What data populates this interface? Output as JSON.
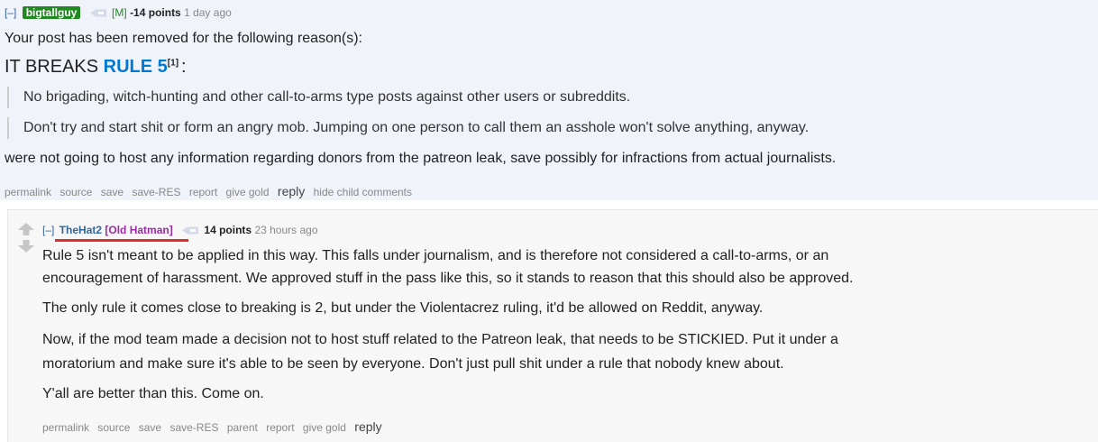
{
  "parent": {
    "expand": "[–]",
    "author": "bigtallguy",
    "mod_tag": "[M]",
    "score": "-14 points",
    "time": "1 day ago",
    "intro": "Your post has been removed for the following reason(s):",
    "breaks_prefix": "IT BREAKS ",
    "rule_label": "RULE 5",
    "footnote": "[1]",
    "breaks_suffix": ":",
    "quote_1": "No brigading, witch-hunting and other call-to-arms type posts against other users or subreddits.",
    "quote_2": "Don't try and start shit or form an angry mob. Jumping on one person to call them an asshole won't solve anything, anyway.",
    "closing": "were not going to host any information regarding donors from the patreon leak, save possibly for infractions from actual journalists.",
    "actions": {
      "permalink": "permalink",
      "source": "source",
      "save": "save",
      "save_res": "save-RES",
      "report": "report",
      "give_gold": "give gold",
      "reply": "reply",
      "hide_child": "hide child comments"
    }
  },
  "child": {
    "expand": "[–]",
    "author": "TheHat2",
    "flair": "[Old Hatman]",
    "score": "14 points",
    "time": "23 hours ago",
    "p1_line1": "Rule 5 isn't meant to be applied in this way. This falls under journalism, and is therefore not considered a call-to-arms, or an",
    "p1_line2": "encouragement of harassment. We approved stuff in the pass like this, so it stands to reason that this should also be approved.",
    "p2": "The only rule it comes close to breaking is 2, but under the Violentacrez ruling, it'd be allowed on Reddit, anyway.",
    "p3_line1": "Now, if the mod team made a decision not to host stuff related to the Patreon leak, that needs to be STICKIED. Put it under a",
    "p3_line2": "moratorium and make sure it's able to be seen by everyone. Don't just pull shit under a rule that nobody knew about.",
    "p4": "Y'all are better than this. Come on.",
    "actions": {
      "permalink": "permalink",
      "source": "source",
      "save": "save",
      "save_res": "save-RES",
      "parent": "parent",
      "report": "report",
      "give_gold": "give gold",
      "reply": "reply"
    }
  },
  "colors": {
    "mod_green": "#228822",
    "rule_blue": "#0079d3",
    "flair_purple": "#9b2aa6",
    "underline_red": "#d9302c"
  },
  "icons": [
    "mail-icon",
    "upvote-arrow-icon",
    "downvote-arrow-icon"
  ]
}
